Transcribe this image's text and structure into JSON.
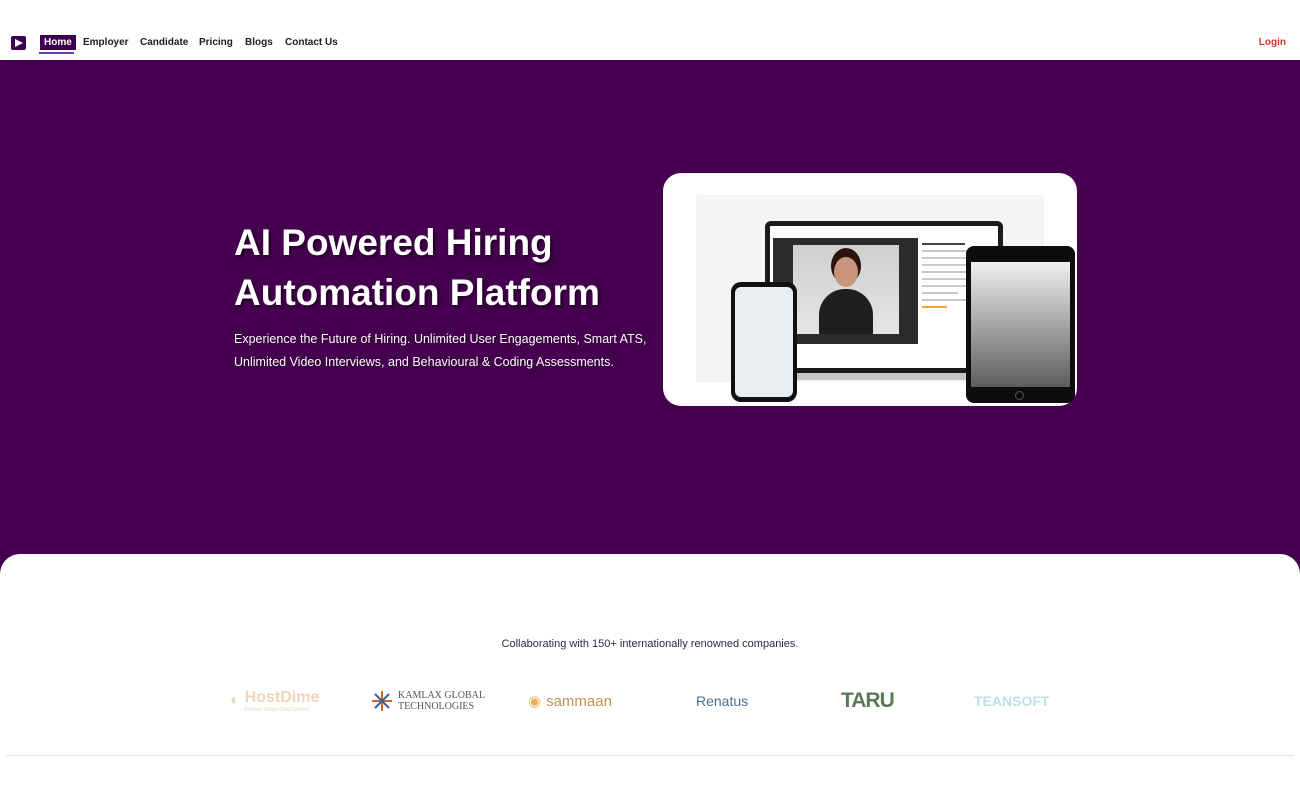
{
  "nav": {
    "logo_icon": "play-triangle-logo-icon",
    "items": [
      {
        "label": "Home",
        "active": true
      },
      {
        "label": "Employer"
      },
      {
        "label": "Candidate"
      },
      {
        "label": "Pricing"
      },
      {
        "label": "Blogs"
      },
      {
        "label": "Contact Us"
      }
    ],
    "login_label": "Login"
  },
  "hero": {
    "title": "AI Powered Hiring Automation Platform",
    "subtitle": "Experience the Future of Hiring. Unlimited User Engagements, Smart ATS, Unlimited Video Interviews, and Behavioural & Coding Assessments.",
    "mockup_icon": "devices-mockup-image"
  },
  "partners": {
    "heading": "Collaborating with 150+ internationally renowned companies.",
    "logos": [
      {
        "name": "HostDime",
        "tagline": "Premier Global Data Centers"
      },
      {
        "name": "KAMLAX GLOBAL TECHNOLOGIES"
      },
      {
        "name": "sammaan"
      },
      {
        "name": "Renatus"
      },
      {
        "name": "TARU"
      },
      {
        "name": "TEANSOFT"
      }
    ]
  },
  "colors": {
    "hero_bg": "#460050",
    "nav_active": "#3d0050",
    "login": "#d9362b"
  }
}
